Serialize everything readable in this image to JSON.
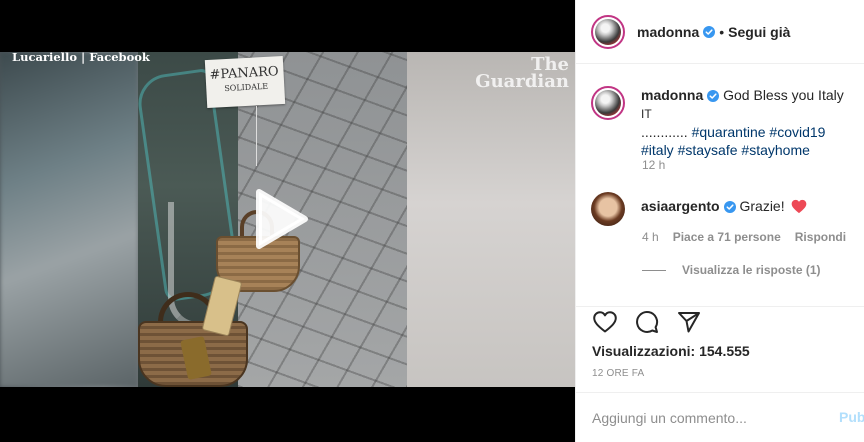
{
  "video": {
    "credit": "Lucariello | Facebook",
    "watermark_line1": "The",
    "watermark_line2": "Guardian",
    "sign_line1": "#PANARO",
    "sign_line2": "SOLIDALE"
  },
  "header": {
    "username": "madonna",
    "separator": "•",
    "follow_label": "Segui già"
  },
  "caption": {
    "username": "madonna",
    "text_start": " God Bless you Italy ",
    "flag": "IT",
    "dots": " ............ ",
    "tags": [
      "#quarantine",
      "#covid19",
      "#italy",
      "#staysafe",
      "#stayhome"
    ],
    "time": "12 h"
  },
  "reply": {
    "username": "asiaargento",
    "text": "Grazie!",
    "time": "4 h",
    "likes": "Piace a 71 persone",
    "reply_label": "Rispondi",
    "view_replies": "Visualizza le risposte (1)"
  },
  "actions": {
    "views": "Visualizzazioni: 154.555",
    "posted": "12 ORE FA"
  },
  "add_comment": {
    "placeholder": "Aggiungi un commento...",
    "publish": "Pubblica"
  },
  "colors": {
    "verified": "#3897f0",
    "hashtag": "#00376b",
    "heart": "#ed4956",
    "publish_disabled": "#b2dffc"
  }
}
